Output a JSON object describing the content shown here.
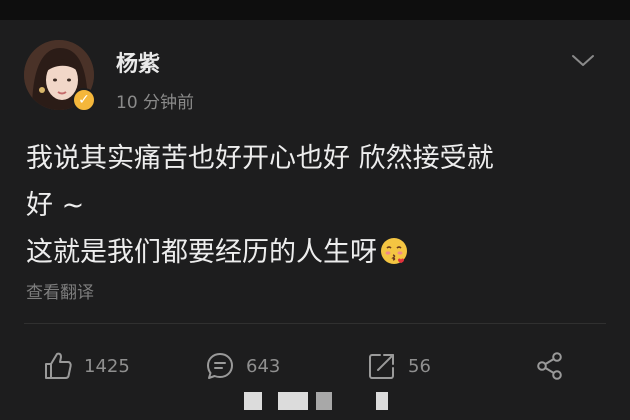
{
  "post": {
    "author": "杨紫",
    "time": "10 分钟前",
    "line1": "我说其实痛苦也好开心也好 欣然接受就",
    "line2": "好 ~",
    "line3": "这就是我们都要经历的人生呀",
    "translate_label": "查看翻译"
  },
  "actions": {
    "like_count": "1425",
    "comment_count": "643",
    "repost_count": "56"
  },
  "icons": [
    "verified-icon",
    "chevron-down-icon",
    "thumbs-up-icon",
    "comment-icon",
    "repost-icon",
    "share-icon",
    "kissing-emoji-icon"
  ],
  "colors": {
    "background": "#1d1d1e",
    "text": "#ededed",
    "muted": "#8a8a8a",
    "verified": "#f5b73b"
  }
}
